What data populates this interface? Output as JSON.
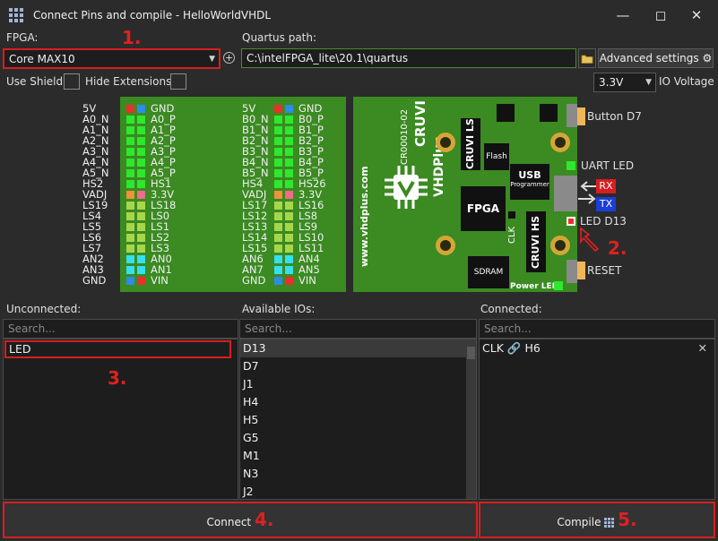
{
  "window": {
    "title": "Connect Pins and compile - HelloWorldVHDL"
  },
  "fpga": {
    "label": "FPGA:",
    "value": "Core MAX10"
  },
  "quartus": {
    "label": "Quartus path:",
    "value": "C:\\intelFPGA_lite\\20.1\\quartus"
  },
  "advanced_settings": "Advanced settings",
  "use_shield": "Use Shield",
  "hide_extensions": "Hide Extensions",
  "io_voltage": {
    "value": "3.3V",
    "label": "IO Voltage"
  },
  "board": {
    "left_outer": [
      "5V",
      "A0_N",
      "A1_N",
      "A2_N",
      "A3_N",
      "A4_N",
      "A5_N",
      "HS2",
      "VADJ",
      "LS19",
      "LS4",
      "LS5",
      "LS6",
      "LS7",
      "AN2",
      "AN3",
      "GND"
    ],
    "left_inner": [
      "GND",
      "A0_P",
      "A1_P",
      "A2_P",
      "A3_P",
      "A4_P",
      "A5_P",
      "HS1",
      "3.3V",
      "LS18",
      "LS0",
      "LS1",
      "LS2",
      "LS3",
      "AN0",
      "AN1",
      "VIN"
    ],
    "right_outer": [
      "5V",
      "B0_N",
      "B1_N",
      "B2_N",
      "B3_N",
      "B4_N",
      "B5_N",
      "HS4",
      "VADJ",
      "LS17",
      "LS12",
      "LS13",
      "LS14",
      "LS15",
      "AN6",
      "AN7",
      "GND"
    ],
    "right_inner": [
      "GND",
      "B0_P",
      "B1_P",
      "B2_P",
      "B3_P",
      "B4_P",
      "B5_P",
      "HS26",
      "3.3V",
      "LS16",
      "LS8",
      "LS9",
      "LS10",
      "LS11",
      "AN4",
      "AN5",
      "VIN"
    ],
    "pin_colors_a": [
      "#e8312d",
      "#2de82d",
      "#2de82d",
      "#2de82d",
      "#2de82d",
      "#2de82d",
      "#2de82d",
      "#2de82d",
      "#f0923a",
      "#a8d64a",
      "#a8d64a",
      "#a8d64a",
      "#a8d64a",
      "#a8d64a",
      "#35e0f0",
      "#35e0f0",
      "#2b8de8"
    ],
    "pin_colors_b": [
      "#2b8de8",
      "#2de82d",
      "#2de82d",
      "#2de82d",
      "#2de82d",
      "#2de82d",
      "#2de82d",
      "#2de82d",
      "#f06a8a",
      "#a8d64a",
      "#a8d64a",
      "#a8d64a",
      "#a8d64a",
      "#a8d64a",
      "#35e0f0",
      "#35e0f0",
      "#e8312d"
    ],
    "model": "CR00010-02",
    "brand": "CRUVI",
    "product": "VHDPlus",
    "website": "www.vhdplus.com",
    "chip_ls": "CRUVI LS",
    "chip_flash": "Flash",
    "chip_usb": "USB",
    "chip_usb_sub": "Programmer",
    "chip_fpga": "FPGA",
    "chip_sdram": "SDRAM",
    "chip_hs": "CRUVI HS",
    "clk": "CLK",
    "button_d7": "Button D7",
    "uart_led": "UART LED",
    "rx": "RX",
    "tx": "TX",
    "led_d13": "LED D13",
    "reset": "RESET",
    "power_led": "Power LED"
  },
  "unconnected": {
    "title": "Unconnected:",
    "search_placeholder": "Search...",
    "items": [
      "LED"
    ]
  },
  "available": {
    "title": "Available IOs:",
    "search_placeholder": "Search...",
    "items": [
      "D13",
      "D7",
      "J1",
      "H4",
      "H5",
      "G5",
      "M1",
      "N3",
      "J2"
    ]
  },
  "connected": {
    "title": "Connected:",
    "search_placeholder": "Search...",
    "items": [
      {
        "signal": "CLK",
        "pin": "H6"
      }
    ]
  },
  "connect_button": "Connect",
  "compile_button": "Compile",
  "annotations": [
    "1.",
    "2.",
    "3.",
    "4.",
    "5."
  ]
}
